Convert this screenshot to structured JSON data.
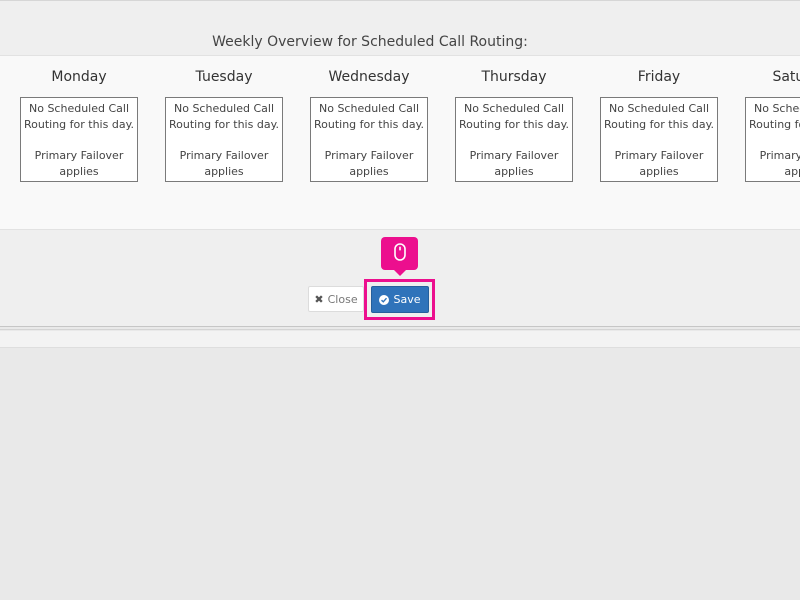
{
  "overview": {
    "title": "Weekly Overview for Scheduled Call Routing:"
  },
  "days": [
    {
      "name": "Monday",
      "line1": "No Scheduled Call",
      "line2": "Routing for this day.",
      "line3": "Primary Failover",
      "line4": "applies"
    },
    {
      "name": "Tuesday",
      "line1": "No Scheduled Call",
      "line2": "Routing for this day.",
      "line3": "Primary Failover",
      "line4": "applies"
    },
    {
      "name": "Wednesday",
      "line1": "No Scheduled Call",
      "line2": "Routing for this day.",
      "line3": "Primary Failover",
      "line4": "applies"
    },
    {
      "name": "Thursday",
      "line1": "No Scheduled Call",
      "line2": "Routing for this day.",
      "line3": "Primary Failover",
      "line4": "applies"
    },
    {
      "name": "Friday",
      "line1": "No Scheduled Call",
      "line2": "Routing for this day.",
      "line3": "Primary Failover",
      "line4": "applies"
    },
    {
      "name": "Saturday",
      "line1": "No Scheduled Call",
      "line2": "Routing for this day.",
      "line3": "Primary Failover",
      "line4": "applies"
    }
  ],
  "actions": {
    "close_label": "Close",
    "save_label": "Save"
  },
  "icons": {
    "close": "times-icon",
    "save": "check-circle-icon",
    "cursor_hint": "mouse-icon"
  },
  "colors": {
    "save_button": "#2f73ba",
    "highlight": "#ec0f8e"
  }
}
